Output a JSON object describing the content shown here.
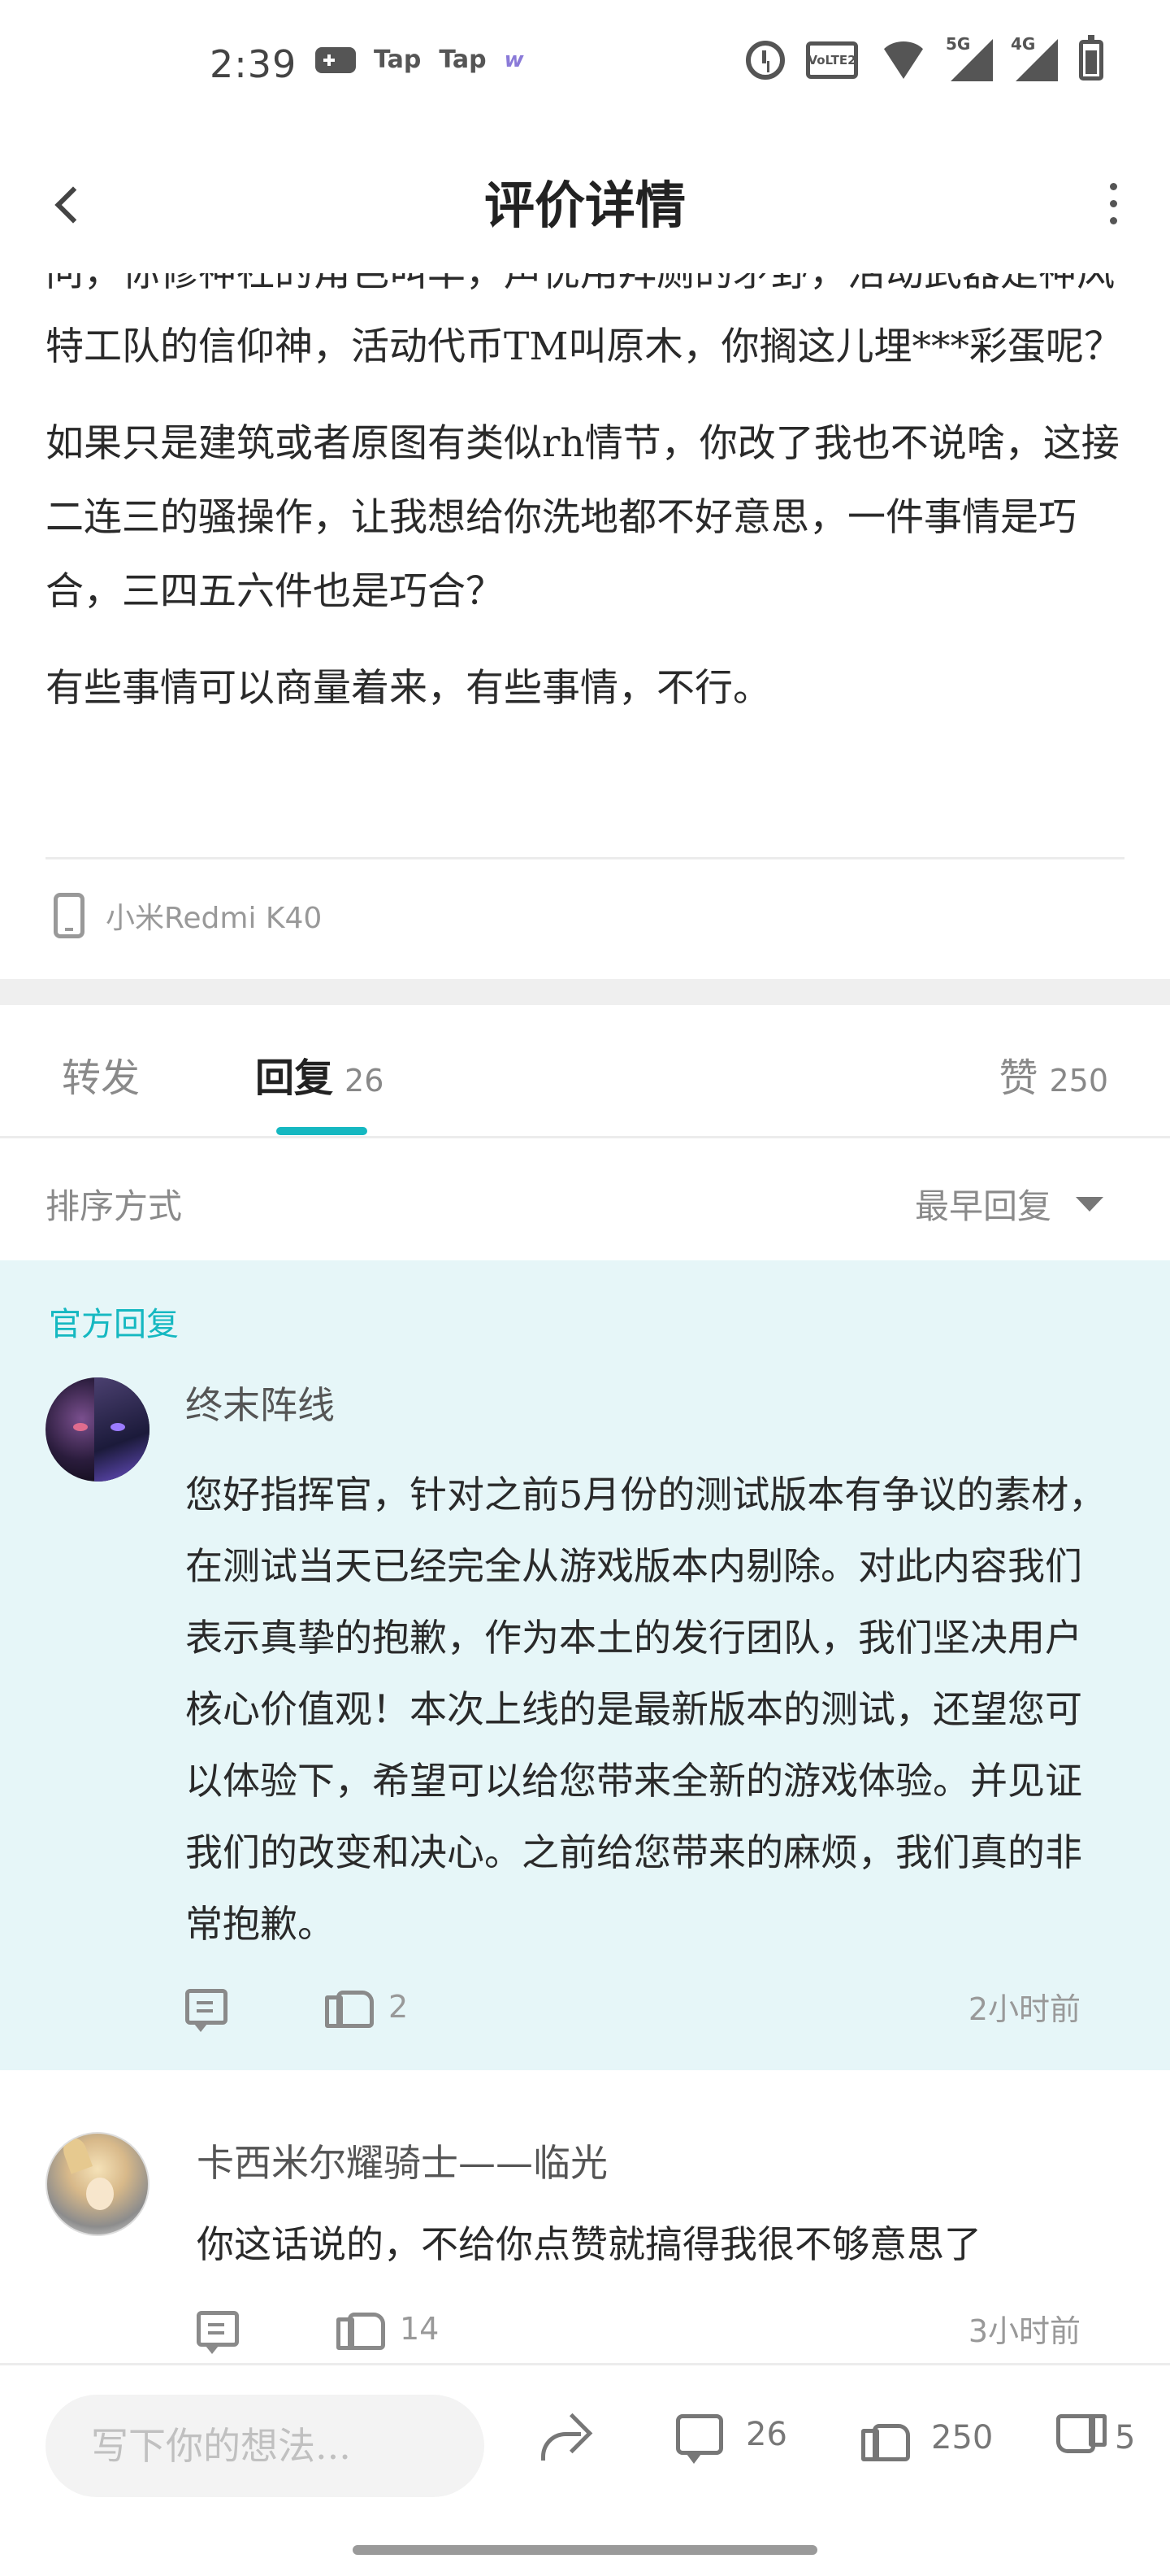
{
  "status_bar": {
    "time": "2:39",
    "left_icons": [
      "gamepad-icon",
      "taptap-icon",
      "taptap-icon",
      "w-app-icon"
    ],
    "taptap_1": "Tap",
    "taptap_2": "Tap",
    "w_app": "w",
    "volte": "VoLTE2",
    "signal_1": "5G",
    "signal_2": "4G",
    "right_icons": [
      "alarm-icon",
      "volte-icon",
      "wifi-icon",
      "signal-5g-icon",
      "signal-4g-icon",
      "battery-icon"
    ]
  },
  "header": {
    "title": "评价详情",
    "back_icon": "chevron-left-icon",
    "more_icon": "more-vertical-icon"
  },
  "article": {
    "paragraphs": [
      "问，你修神社的角色叫华，声优用拜厕的矛野，活动武器是神风特工队的信仰神，活动代币TM叫原木，你搁这儿埋***彩蛋呢？",
      "如果只是建筑或者原图有类似rh情节，你改了我也不说啥，这接二连三的骚操作，让我想给你洗地都不好意思，一件事情是巧合，三四五六件也是巧合？",
      "有些事情可以商量着来，有些事情，不行。"
    ],
    "device": "小米Redmi K40"
  },
  "tabs": {
    "forward_label": "转发",
    "reply_label": "回复",
    "reply_count": "26",
    "like_label": "赞",
    "like_count": "250"
  },
  "sort": {
    "label": "排序方式",
    "value": "最早回复"
  },
  "official_reply": {
    "tag": "官方回复",
    "author": "终末阵线",
    "body": "您好指挥官，针对之前5月份的测试版本有争议的素材，在测试当天已经完全从游戏版本内剔除。对此内容我们表示真挚的抱歉，作为本土的发行团队，我们坚决用户核心价值观！本次上线的是最新版本的测试，还望您可以体验下，希望可以给您带来全新的游戏体验。并见证我们的改变和决心。之前给您带来的麻烦，我们真的非常抱歉。",
    "likes": "2",
    "time": "2小时前"
  },
  "reply_2": {
    "author": "卡西米尔耀骑士——临光",
    "body": "你这话说的，不给你点赞就搞得我很不够意思了",
    "likes": "14",
    "time": "3小时前"
  },
  "bottom_bar": {
    "input_placeholder": "写下你的想法...",
    "comment_count": "26",
    "like_count": "250",
    "dislike_count": "5"
  },
  "colors": {
    "accent": "#15b8c1",
    "official_bg": "#e6f6f8"
  }
}
